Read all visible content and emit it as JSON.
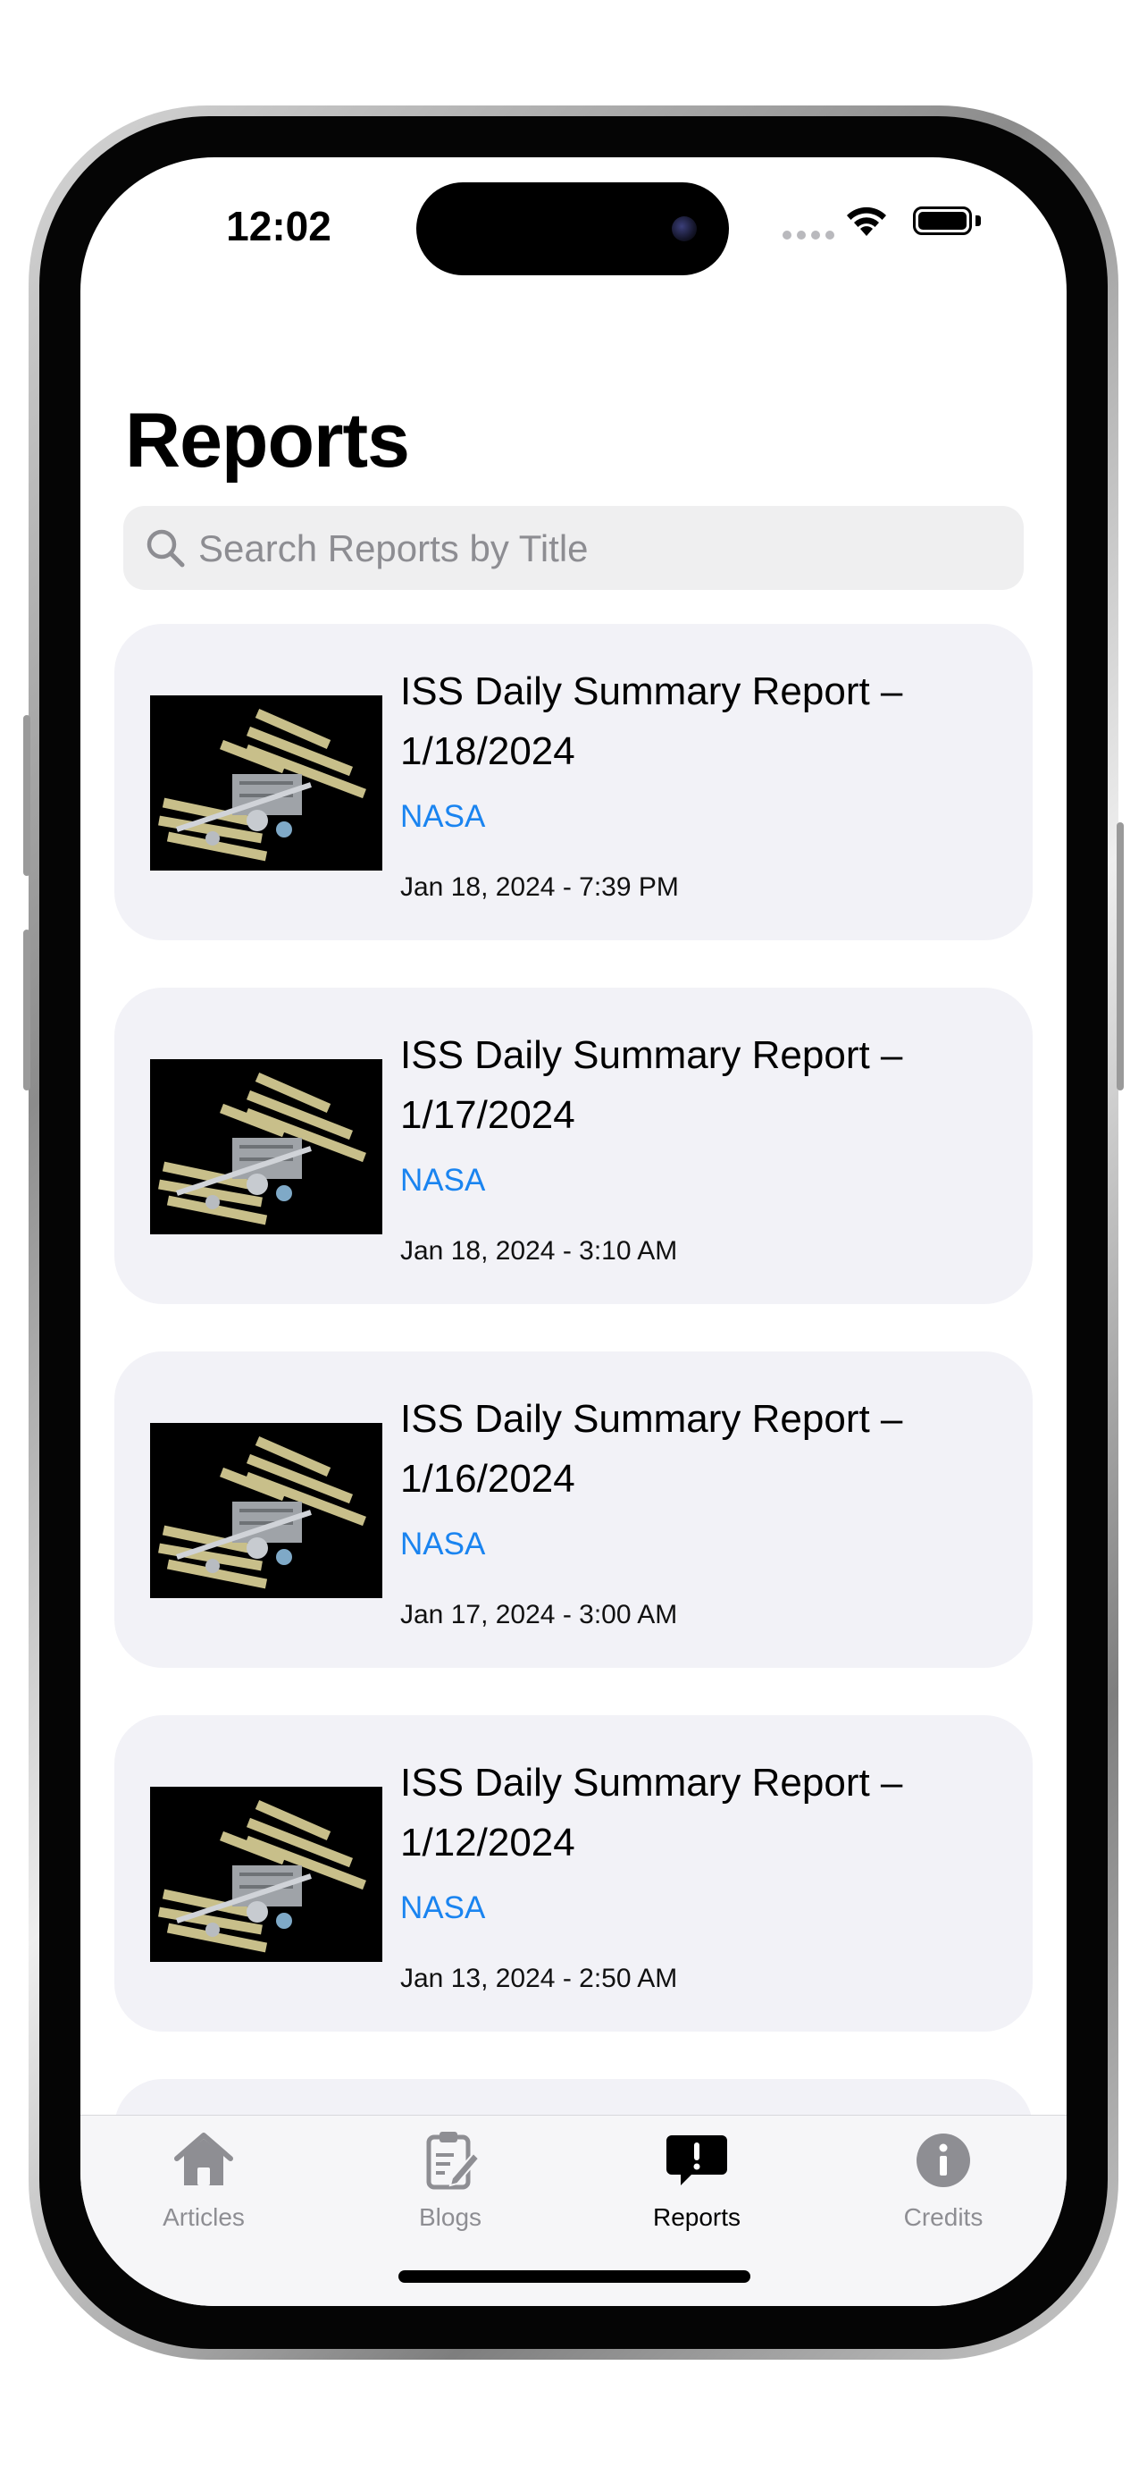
{
  "status_bar": {
    "time": "12:02"
  },
  "page": {
    "title": "Reports"
  },
  "search": {
    "placeholder": "Search Reports by Title",
    "value": ""
  },
  "reports": [
    {
      "title": "ISS Daily Summary Report – 1/18/2024",
      "source": "NASA",
      "date": "Jan 18, 2024 - 7:39 PM"
    },
    {
      "title": "ISS Daily Summary Report – 1/17/2024",
      "source": "NASA",
      "date": "Jan 18, 2024 - 3:10 AM"
    },
    {
      "title": "ISS Daily Summary Report – 1/16/2024",
      "source": "NASA",
      "date": "Jan 17, 2024 - 3:00 AM"
    },
    {
      "title": "ISS Daily Summary Report – 1/12/2024",
      "source": "NASA",
      "date": "Jan 13, 2024 - 2:50 AM"
    }
  ],
  "tab_bar": {
    "active_tab": "Reports",
    "tabs": [
      {
        "label": "Articles",
        "icon": "house-icon"
      },
      {
        "label": "Blogs",
        "icon": "clipboard-pencil-icon"
      },
      {
        "label": "Reports",
        "icon": "exclamation-bubble-icon"
      },
      {
        "label": "Credits",
        "icon": "info-circle-icon"
      }
    ]
  },
  "colors": {
    "link_blue": "#1a84f0",
    "card_background": "#f2f2f7",
    "inactive_tab": "#8e8e93",
    "active_tab": "#000000"
  }
}
